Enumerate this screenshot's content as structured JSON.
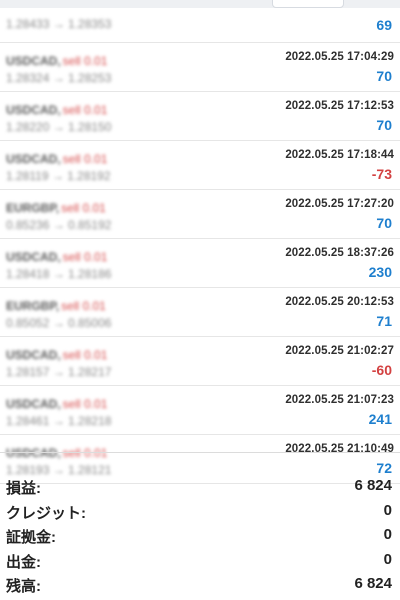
{
  "trades": [
    {
      "symbol": "USDCAD,",
      "action": "sell 0.01",
      "date": "",
      "prices": "1.28433 → 1.28353",
      "profit": "69",
      "sign": "pos"
    },
    {
      "symbol": "USDCAD,",
      "action": "sell 0.01",
      "date": "2022.05.25 17:04:29",
      "prices": "1.28324 → 1.28253",
      "profit": "70",
      "sign": "pos"
    },
    {
      "symbol": "USDCAD,",
      "action": "sell 0.01",
      "date": "2022.05.25 17:12:53",
      "prices": "1.28220 → 1.28150",
      "profit": "70",
      "sign": "pos"
    },
    {
      "symbol": "USDCAD,",
      "action": "sell 0.01",
      "date": "2022.05.25 17:18:44",
      "prices": "1.28119 → 1.28192",
      "profit": "-73",
      "sign": "neg"
    },
    {
      "symbol": "EURGBP,",
      "action": "sell 0.01",
      "date": "2022.05.25 17:27:20",
      "prices": "0.85236 → 0.85192",
      "profit": "70",
      "sign": "pos"
    },
    {
      "symbol": "USDCAD,",
      "action": "sell 0.01",
      "date": "2022.05.25 18:37:26",
      "prices": "1.28418 → 1.28186",
      "profit": "230",
      "sign": "pos"
    },
    {
      "symbol": "EURGBP,",
      "action": "sell 0.01",
      "date": "2022.05.25 20:12:53",
      "prices": "0.85052 → 0.85006",
      "profit": "71",
      "sign": "pos"
    },
    {
      "symbol": "USDCAD,",
      "action": "sell 0.01",
      "date": "2022.05.25 21:02:27",
      "prices": "1.28157 → 1.28217",
      "profit": "-60",
      "sign": "neg"
    },
    {
      "symbol": "USDCAD,",
      "action": "sell 0.01",
      "date": "2022.05.25 21:07:23",
      "prices": "1.28461 → 1.28218",
      "profit": "241",
      "sign": "pos"
    },
    {
      "symbol": "USDCAD,",
      "action": "sell 0.01",
      "date": "2022.05.25 21:10:49",
      "prices": "1.28193 → 1.28121",
      "profit": "72",
      "sign": "pos"
    }
  ],
  "summary": [
    {
      "label": "損益:",
      "value": "6 824"
    },
    {
      "label": "クレジット:",
      "value": "0"
    },
    {
      "label": "証拠金:",
      "value": "0"
    },
    {
      "label": "出金:",
      "value": "0"
    },
    {
      "label": "残高:",
      "value": "6 824"
    }
  ],
  "colors": {
    "positive": "#1e7fce",
    "negative": "#d34141"
  }
}
